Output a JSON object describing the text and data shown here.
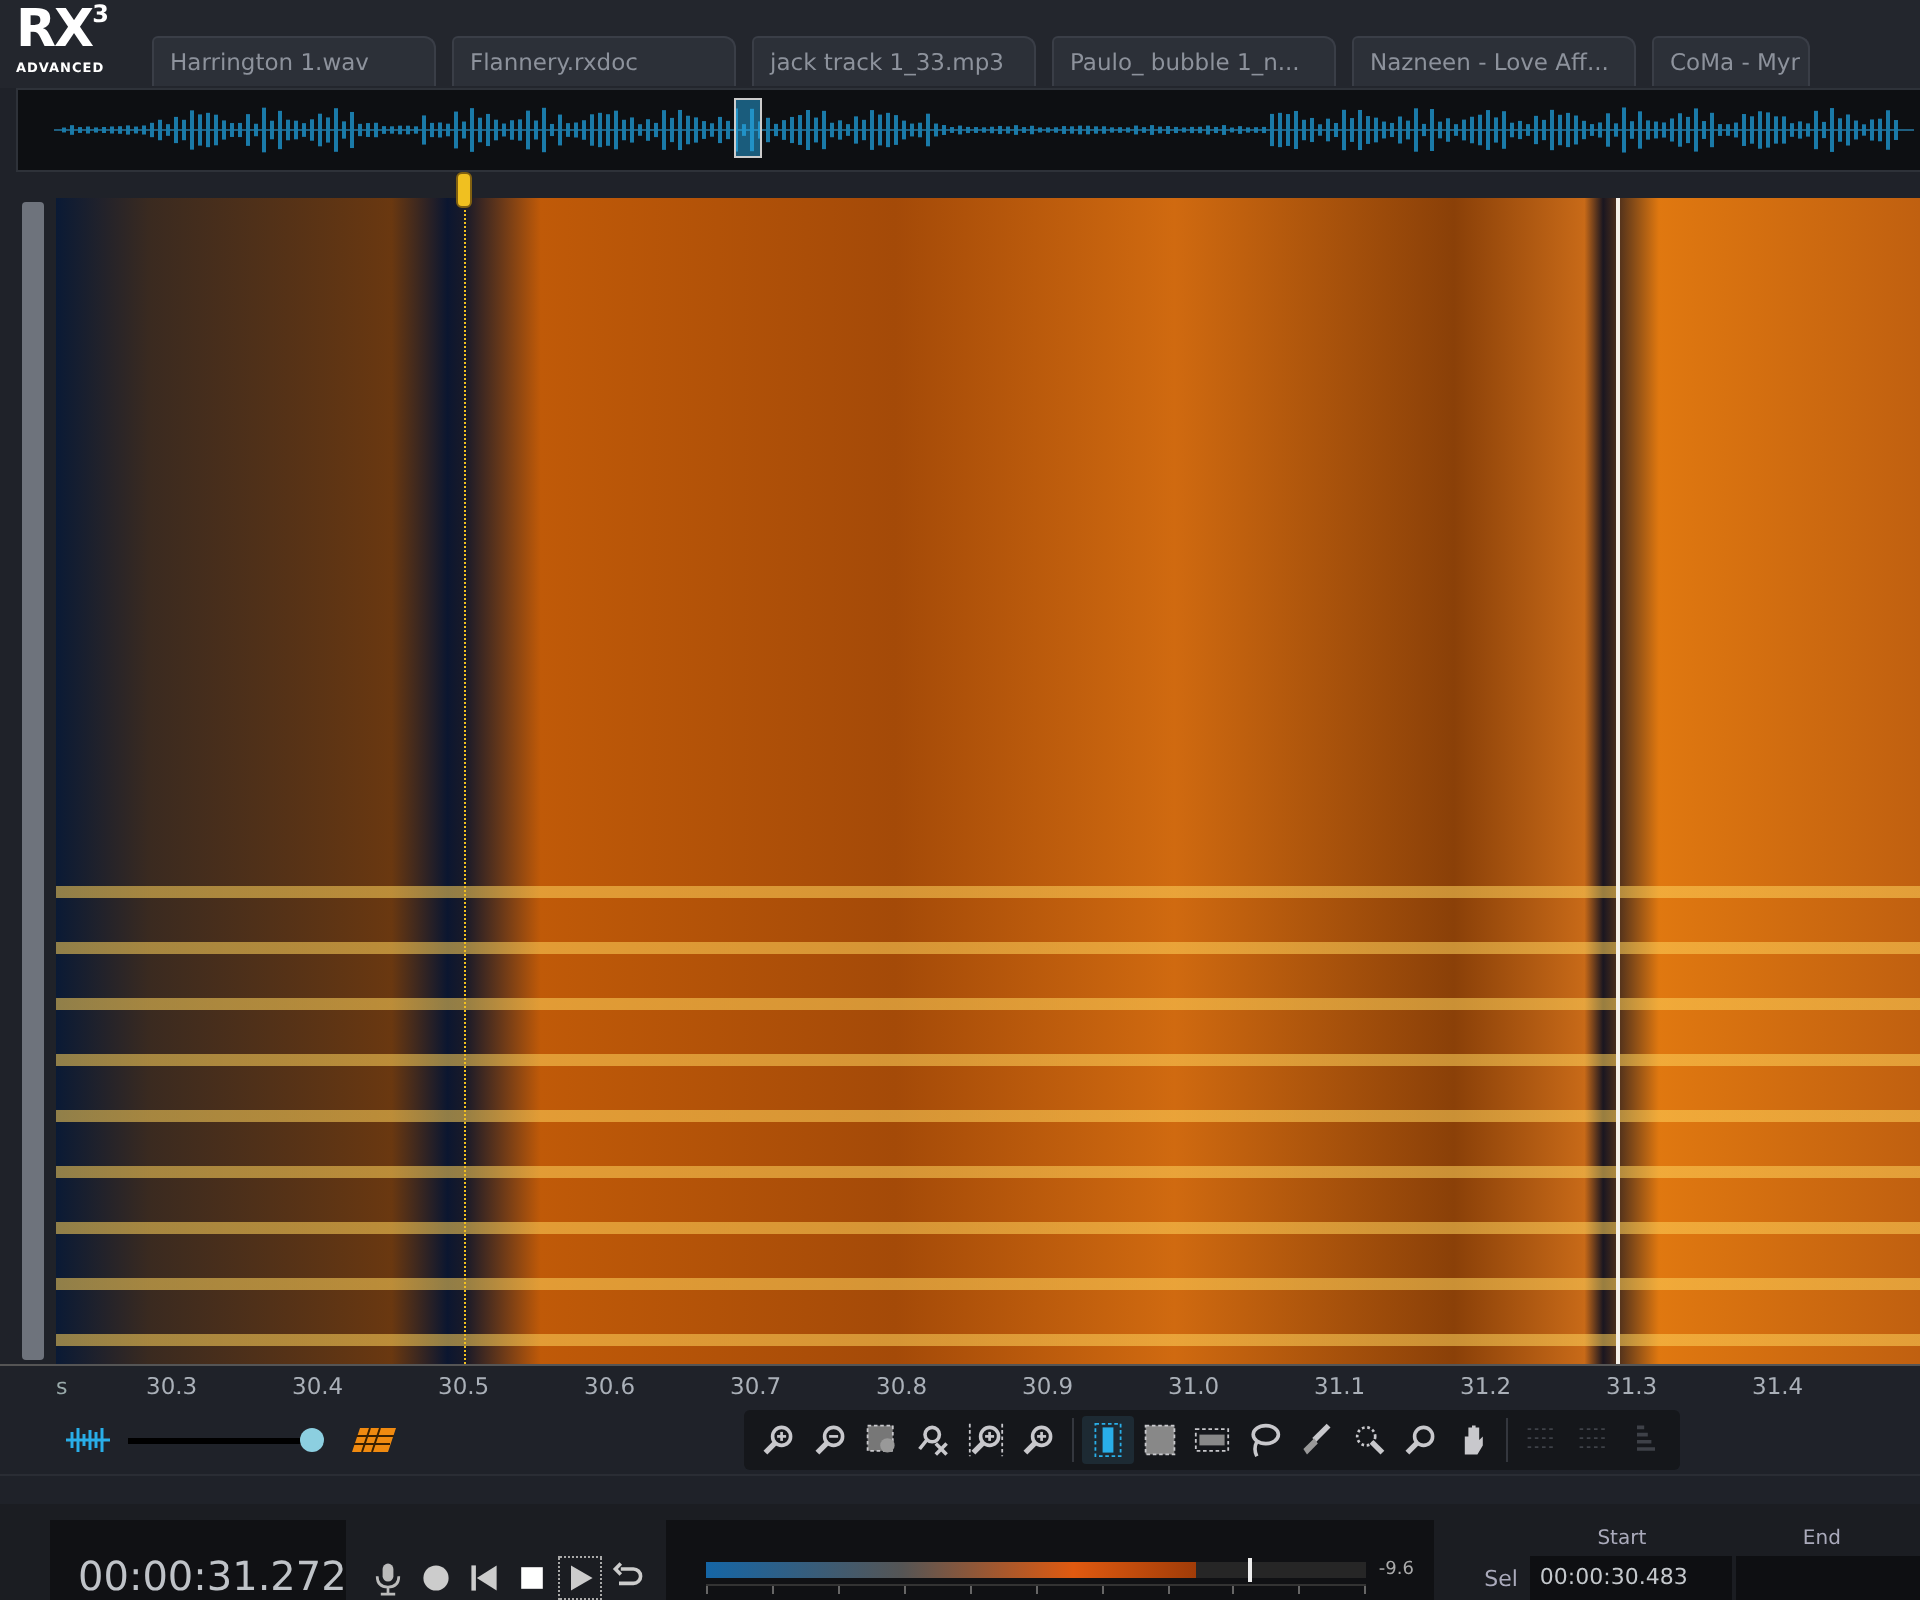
{
  "logo": {
    "text": "RX",
    "sup": "3",
    "edition": "ADVANCED"
  },
  "tabs": [
    {
      "label": "Harrington 1.wav"
    },
    {
      "label": "Flannery.rxdoc"
    },
    {
      "label": "jack track 1_33.mp3"
    },
    {
      "label": "Paulo_ bubble 1_n..."
    },
    {
      "label": "Nazneen - Love Aff..."
    },
    {
      "label": "CoMa - Myr"
    }
  ],
  "time_axis": {
    "unit": "s",
    "ticks": [
      "30.3",
      "30.4",
      "30.5",
      "30.6",
      "30.7",
      "30.8",
      "30.9",
      "31.0",
      "31.1",
      "31.2",
      "31.3",
      "31.4"
    ]
  },
  "blend_slider": {
    "level": 1.0
  },
  "tools": [
    {
      "kind": "zoom-in",
      "selected": false,
      "disabled": false
    },
    {
      "kind": "zoom-out",
      "selected": false,
      "disabled": false
    },
    {
      "kind": "zoom-selection",
      "selected": false,
      "disabled": false
    },
    {
      "kind": "zoom-reset",
      "selected": false,
      "disabled": false
    },
    {
      "kind": "zoom-time",
      "selected": false,
      "disabled": false
    },
    {
      "kind": "zoom-freq",
      "selected": false,
      "disabled": false
    },
    {
      "kind": "time-select",
      "selected": true,
      "disabled": false
    },
    {
      "kind": "rect-select",
      "selected": false,
      "disabled": false
    },
    {
      "kind": "freq-select",
      "selected": false,
      "disabled": false
    },
    {
      "kind": "lasso",
      "selected": false,
      "disabled": false
    },
    {
      "kind": "brush",
      "selected": false,
      "disabled": false
    },
    {
      "kind": "wand",
      "selected": false,
      "disabled": false
    },
    {
      "kind": "magnify",
      "selected": false,
      "disabled": false
    },
    {
      "kind": "hand",
      "selected": false,
      "disabled": false
    },
    {
      "kind": "harmonic",
      "selected": false,
      "disabled": true
    },
    {
      "kind": "harmonic",
      "selected": false,
      "disabled": true
    },
    {
      "kind": "bars",
      "selected": false,
      "disabled": true
    }
  ],
  "time_display": "00:00:31.272",
  "transport": [
    {
      "kind": "mic",
      "focused": false
    },
    {
      "kind": "record",
      "focused": false
    },
    {
      "kind": "rewind",
      "focused": false
    },
    {
      "kind": "stop",
      "focused": false
    },
    {
      "kind": "play",
      "focused": true
    },
    {
      "kind": "loop",
      "focused": false
    }
  ],
  "meter": {
    "level": 0.74,
    "reading": "-9.6"
  },
  "selection": {
    "headers": [
      "Start",
      "End"
    ],
    "rows": [
      {
        "label": "Sel",
        "start": "00:00:30.483"
      }
    ]
  }
}
